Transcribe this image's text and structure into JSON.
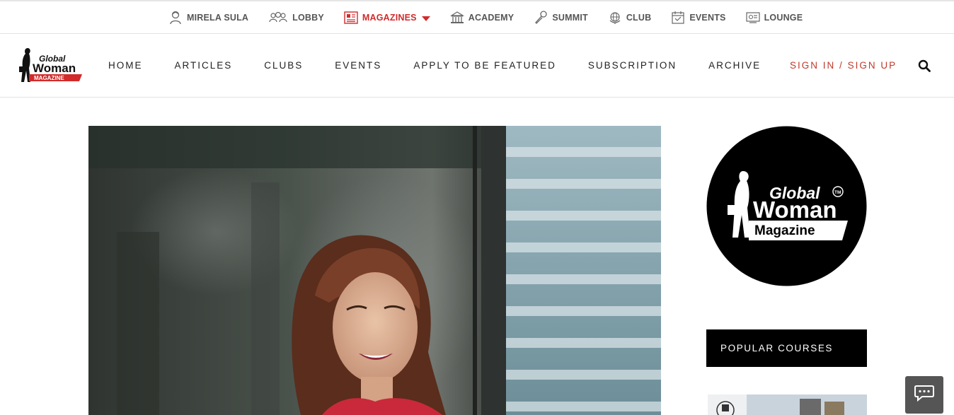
{
  "topbar": {
    "items": [
      {
        "label": "MIRELA SULA",
        "icon": "user-icon"
      },
      {
        "label": "LOBBY",
        "icon": "people-icon"
      },
      {
        "label": "MAGAZINES",
        "icon": "magazine-icon",
        "active": true
      },
      {
        "label": "ACADEMY",
        "icon": "academy-icon"
      },
      {
        "label": "SUMMIT",
        "icon": "microphone-icon"
      },
      {
        "label": "CLUB",
        "icon": "globe-icon"
      },
      {
        "label": "EVENTS",
        "icon": "calendar-icon"
      },
      {
        "label": "LOUNGE",
        "icon": "lounge-icon"
      }
    ],
    "active_color": "#d12b2b"
  },
  "logo": {
    "line1": "Global",
    "line2": "Woman",
    "line3": "MAGAZINE"
  },
  "nav": {
    "items": [
      "HOME",
      "ARTICLES",
      "CLUBS",
      "EVENTS",
      "APPLY TO BE FEATURED",
      "SUBSCRIPTION",
      "ARCHIVE"
    ],
    "signin": "SIGN IN",
    "separator": "/",
    "signup": "SIGN UP",
    "accent": "#c0392b"
  },
  "sidebar": {
    "circle_logo": {
      "line1": "Global",
      "line2": "Woman",
      "tm": "TM",
      "line3": "Magazine"
    },
    "popular_courses": "POPULAR COURSES"
  },
  "chat": {
    "icon": "chat-icon"
  }
}
